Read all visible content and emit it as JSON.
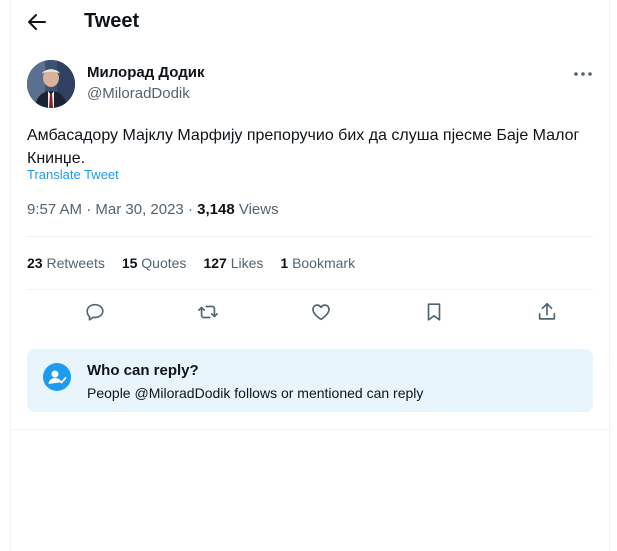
{
  "header": {
    "title": "Tweet",
    "back_icon": "arrow-left-icon"
  },
  "author": {
    "name": "Милорад Додик",
    "handle": "@MiloradDodik",
    "more_icon": "more-horizontal-icon"
  },
  "tweet": {
    "text": "Амбасадору Мајклу Марфију препоручио бих да слуша пјесме Баје Малог Книнџе.",
    "translate_label": "Translate Tweet",
    "time": "9:57 AM",
    "date": "Mar 30, 2023",
    "views_count": "3,148",
    "views_label": "Views"
  },
  "stats": {
    "retweets_count": "23",
    "retweets_label": "Retweets",
    "quotes_count": "15",
    "quotes_label": "Quotes",
    "likes_count": "127",
    "likes_label": "Likes",
    "bookmarks_count": "1",
    "bookmarks_label": "Bookmark"
  },
  "actions": [
    "reply-icon",
    "retweet-icon",
    "like-icon",
    "bookmark-icon",
    "share-icon"
  ],
  "reply_restriction": {
    "title": "Who can reply?",
    "description": "People @MiloradDodik follows or mentioned can reply"
  },
  "colors": {
    "accent": "#1d9bf0",
    "secondary_text": "#536471",
    "reply_box_bg": "#e8f5fd"
  }
}
